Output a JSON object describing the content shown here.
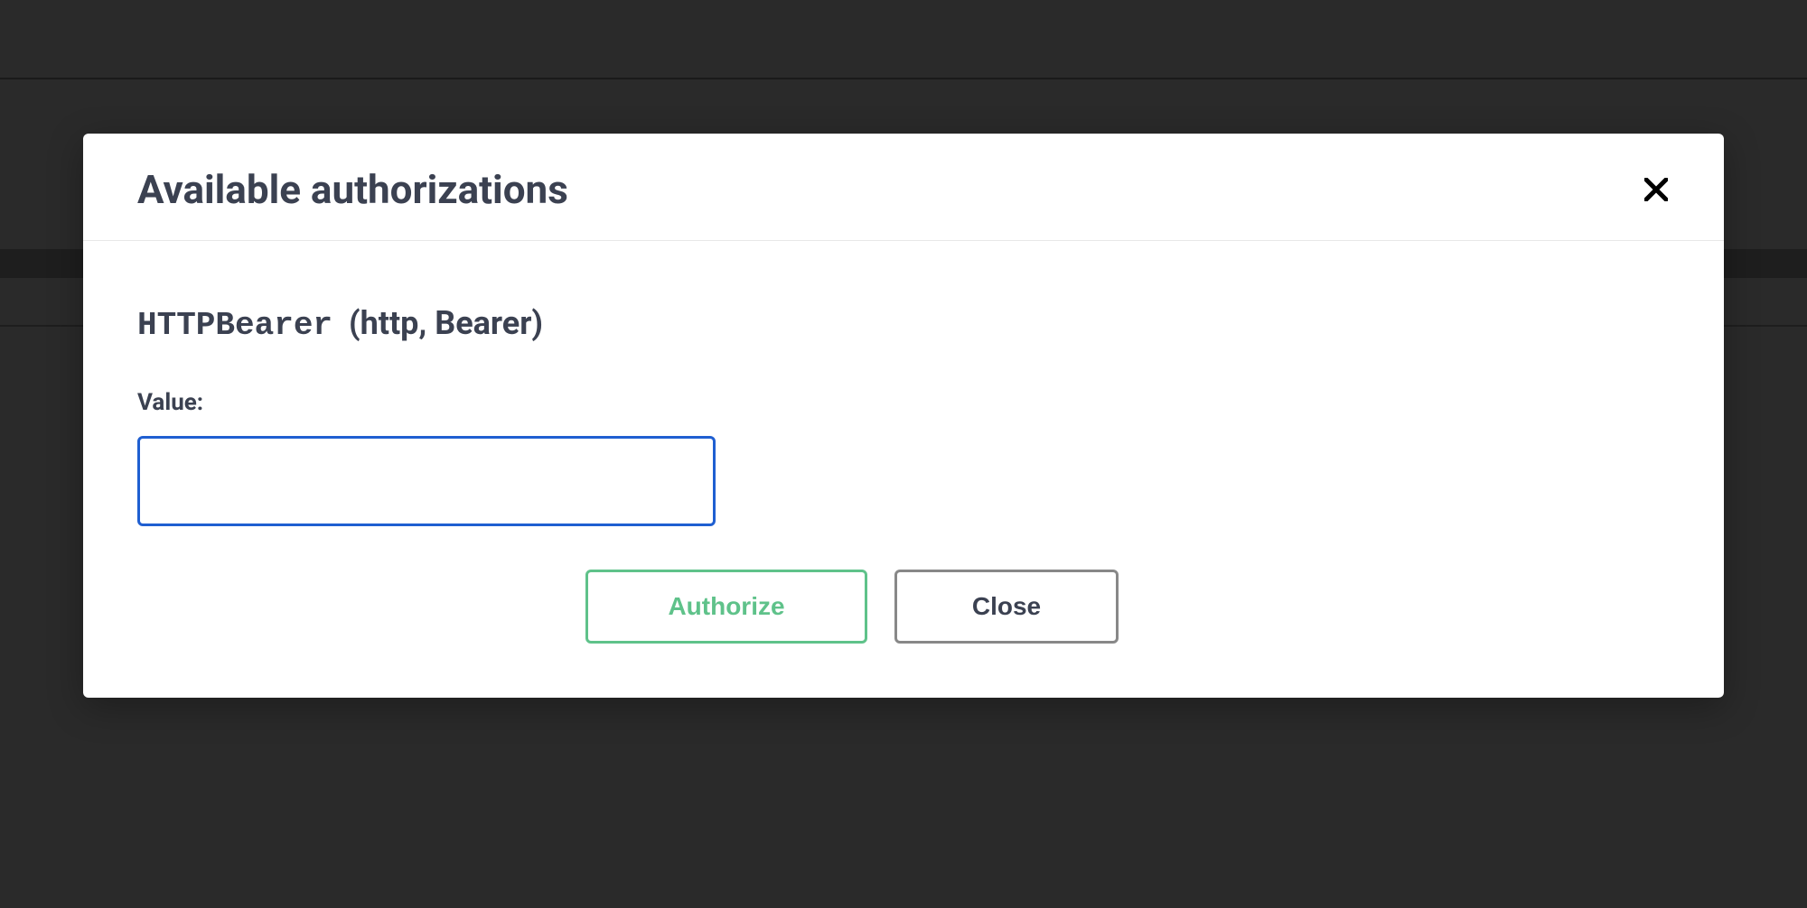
{
  "modal": {
    "title": "Available authorizations",
    "scheme": {
      "name": "HTTPBearer",
      "type": "(http, Bearer)"
    },
    "field": {
      "label": "Value:",
      "value": ""
    },
    "buttons": {
      "authorize": "Authorize",
      "close": "Close"
    }
  }
}
